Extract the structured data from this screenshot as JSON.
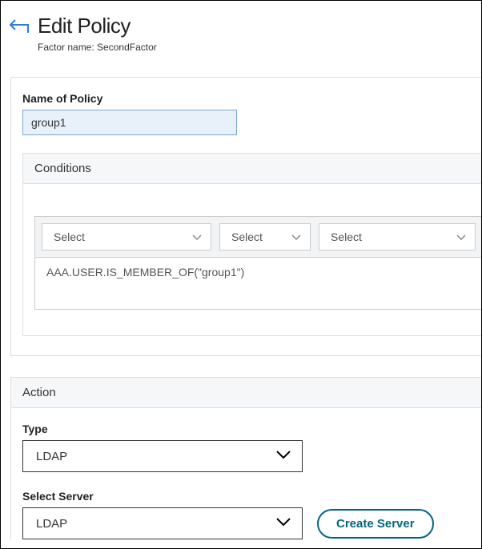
{
  "header": {
    "title": "Edit Policy",
    "factor_label": "Factor name:",
    "factor_value": "SecondFactor"
  },
  "policy_name": {
    "label": "Name of Policy",
    "value": "group1"
  },
  "conditions": {
    "title": "Conditions",
    "selects": [
      "Select",
      "Select",
      "Select"
    ],
    "expression": "AAA.USER.IS_MEMBER_OF(\"group1\")"
  },
  "action": {
    "title": "Action",
    "type_label": "Type",
    "type_value": "LDAP",
    "server_label": "Select Server",
    "server_value": "LDAP",
    "create_button": "Create Server"
  }
}
